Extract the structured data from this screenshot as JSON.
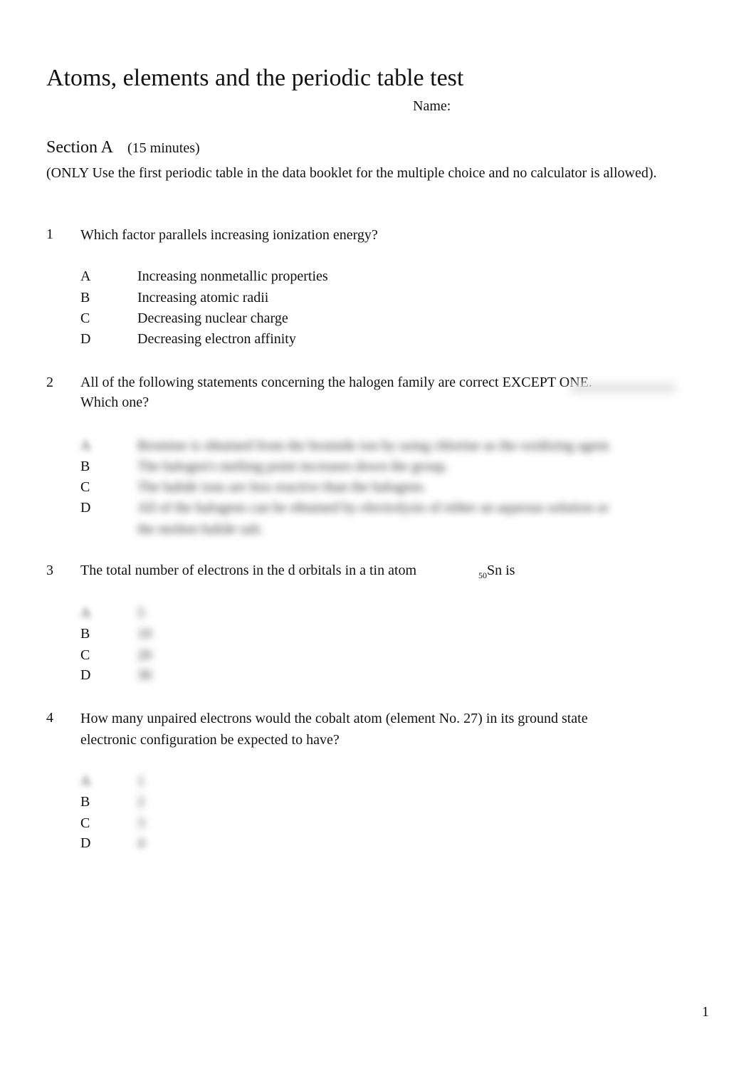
{
  "document": {
    "title": "Atoms, elements and the periodic table test",
    "name_label": "Name:",
    "section": {
      "label": "Section A",
      "duration": "(15 minutes)",
      "instructions": "(ONLY Use the first periodic table in the data booklet for the multiple choice and no calculator is allowed)."
    },
    "questions": [
      {
        "number": "1",
        "text": "Which factor parallels increasing ionization energy?",
        "options": [
          {
            "letter": "A",
            "text": "Increasing nonmetallic properties"
          },
          {
            "letter": "B",
            "text": "Increasing atomic radii"
          },
          {
            "letter": "C",
            "text": "Decreasing nuclear charge"
          },
          {
            "letter": "D",
            "text": "Decreasing electron affinity"
          }
        ]
      },
      {
        "number": "2",
        "text_line1": "All of the following statements concerning the halogen family are correct EXCEPT ONE.",
        "text_line2": "Which one?",
        "options_blurred": true,
        "options": [
          {
            "letter": "A",
            "text": "Bromine is obtained from the bromide ion by using chlorine as the oxidizing agent."
          },
          {
            "letter": "B",
            "text": "The halogen's melting point increases down the group."
          },
          {
            "letter": "C",
            "text": "The halide ions are less reactive than the halogens."
          },
          {
            "letter": "D",
            "text_line1": "All of the halogens can be obtained by electrolysis of either an aqueous solution or",
            "text_line2": "the molten halide salt."
          }
        ]
      },
      {
        "number": "3",
        "text": "The total number of electrons in the d orbitals in a tin atom",
        "element_subscript": "50",
        "element_symbol": "Sn is",
        "options_blurred": true,
        "options": [
          {
            "letter": "A",
            "text": "5"
          },
          {
            "letter": "B",
            "text": "10"
          },
          {
            "letter": "C",
            "text": "20"
          },
          {
            "letter": "D",
            "text": "30"
          }
        ]
      },
      {
        "number": "4",
        "text_line1": "How many unpaired electrons would the cobalt atom (element No. 27) in its ground state",
        "text_line2": "electronic configuration be expected to have?",
        "options_blurred": true,
        "options": [
          {
            "letter": "A",
            "text": "1"
          },
          {
            "letter": "B",
            "text": "2"
          },
          {
            "letter": "C",
            "text": "3"
          },
          {
            "letter": "D",
            "text": "4"
          }
        ]
      }
    ],
    "page_number": "1"
  }
}
